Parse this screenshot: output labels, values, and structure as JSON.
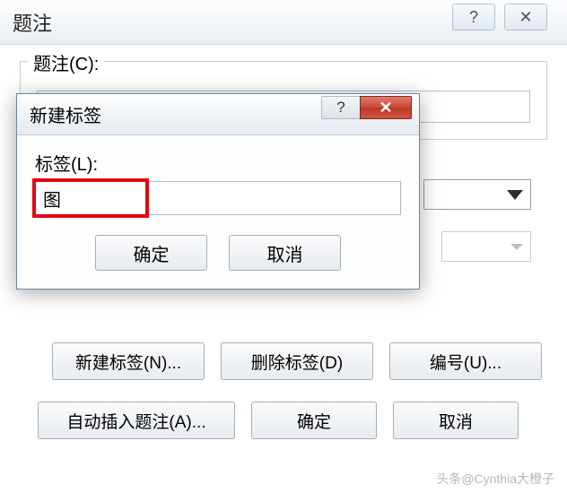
{
  "main": {
    "title": "题注",
    "help_glyph": "?",
    "close_glyph": "✕",
    "caption_label": "题注(C):",
    "caption_value": "",
    "new_label_btn": "新建标签(N)...",
    "delete_label_btn": "删除标签(D)",
    "numbering_btn": "编号(U)...",
    "auto_caption_btn": "自动插入题注(A)...",
    "ok_btn": "确定",
    "cancel_btn": "取消"
  },
  "inner": {
    "title": "新建标签",
    "help_glyph": "?",
    "close_glyph": "✕",
    "label_prompt": "标签(L):",
    "label_value": "图",
    "ok_btn": "确定",
    "cancel_btn": "取消"
  },
  "watermark": "头条@Cynthia大橙子"
}
